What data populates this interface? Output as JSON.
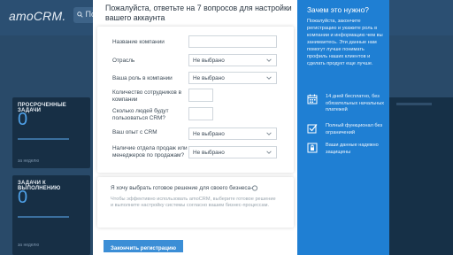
{
  "background_app": {
    "logo": "amoCRM.",
    "search_placeholder": "Поиск",
    "cards": [
      {
        "title": "ПРОСРОЧЕННЫЕ ЗАДАЧИ",
        "value": "0",
        "sub": "за неделю"
      },
      {
        "title": "ЗАДАЧИ К ВЫПОЛНЕНИЮ",
        "value": "0",
        "sub": "за неделю"
      }
    ]
  },
  "modal": {
    "header": "Пожалуйста, ответьте на 7 вопросов для настройки вашего аккаунта",
    "fields": {
      "company_name": {
        "label": "Название компании",
        "value": ""
      },
      "industry": {
        "label": "Отрасль",
        "value": "Не выбрано"
      },
      "role": {
        "label": "Ваша роль в компании",
        "value": "Не выбрано"
      },
      "employees": {
        "label": "Количество сотрудников в компании",
        "value": ""
      },
      "users": {
        "label": "Сколько людей будут пользоваться CRM?",
        "value": ""
      },
      "crm_experience": {
        "label": "Ваш опыт с CRM",
        "value": "Не выбрано"
      },
      "sales_department": {
        "label": "Наличие отдела продаж или менеджеров по продажам?",
        "value": "Не выбрано"
      }
    },
    "solution": {
      "title": "Я хочу выбрать готовое решение для своего бизнеса",
      "description": "Чтобы эффективно использовать amoCRM, выберите готовое решение и выполните настройку системы согласно вашим бизнес-процессам.",
      "enabled": false
    },
    "finish_button": "Закончить регистрацию"
  },
  "info_panel": {
    "title": "Зачем это нужно?",
    "body": "Пожалуйста, закончите регистрацию и укажите роль в компании и информацию чем вы занимаетесь. Эти данные нам помогут лучше понимать профиль наших клиентов и сделать продукт еще лучше.",
    "features": [
      {
        "icon": "calendar-icon",
        "text": "14 дней бесплатно, без обязательных начальных платежей"
      },
      {
        "icon": "checkbox-icon",
        "text": "Полный функционал без ограничений"
      },
      {
        "icon": "shield-icon",
        "text": "Ваши данные надежно защищены"
      }
    ]
  },
  "colors": {
    "accent": "#1f7fd3",
    "button": "#3b8ed6",
    "background": "#294a69"
  }
}
